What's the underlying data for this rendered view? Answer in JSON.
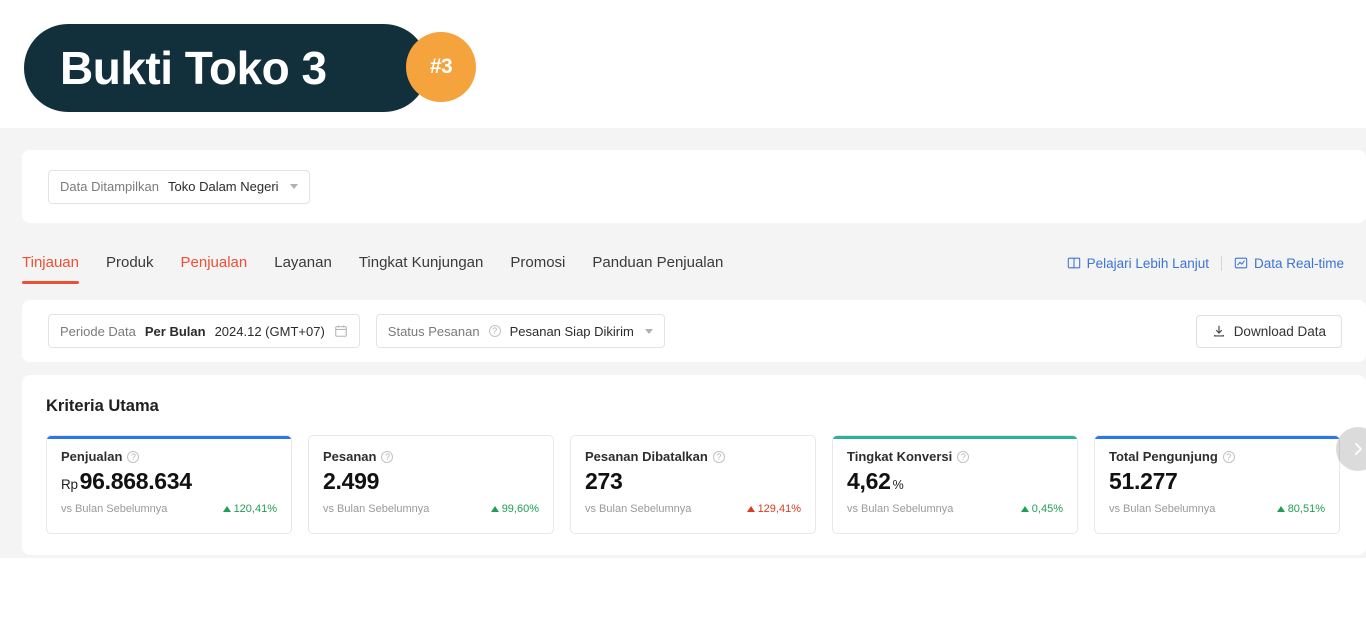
{
  "banner": {
    "title": "Bukti Toko 3",
    "badge": "#3",
    "bg_color": "#12303c",
    "badge_color": "#f5a33c"
  },
  "theme": {
    "accent_red": "#ee5033",
    "link_blue": "#3b74d6",
    "card_blue": "#2878e8",
    "card_green": "#2bb0a0",
    "up_green": "#1f9f55",
    "down_red": "#dd3a20"
  },
  "data_scope": {
    "label": "Data Ditampilkan",
    "value": "Toko Dalam Negeri",
    "chevron_icon": "chevron-down-icon"
  },
  "nav": {
    "tabs": [
      {
        "label": "Tinjauan",
        "state": "active"
      },
      {
        "label": "Produk",
        "state": "normal"
      },
      {
        "label": "Penjualan",
        "state": "highlight"
      },
      {
        "label": "Layanan",
        "state": "normal"
      },
      {
        "label": "Tingkat Kunjungan",
        "state": "normal"
      },
      {
        "label": "Promosi",
        "state": "normal"
      },
      {
        "label": "Panduan Penjualan",
        "state": "normal"
      }
    ],
    "links": [
      {
        "label": "Pelajari Lebih Lanjut",
        "icon": "book-icon"
      },
      {
        "label": "Data Real-time",
        "icon": "chart-icon"
      }
    ]
  },
  "filters": {
    "period": {
      "label": "Periode Data",
      "granularity": "Per Bulan",
      "value": "2024.12 (GMT+07)",
      "icon": "calendar-icon"
    },
    "order_status": {
      "label": "Status Pesanan",
      "help_icon": "question-icon",
      "value": "Pesanan Siap Dikirim",
      "chevron_icon": "chevron-down-icon"
    },
    "download": {
      "label": "Download Data",
      "icon": "download-icon"
    }
  },
  "metrics_section": {
    "title": "Kriteria Utama",
    "comparison_label": "vs Bulan Sebelumnya",
    "next_icon": "chevron-right-icon",
    "cards": [
      {
        "title": "Penjualan",
        "help_icon": "question-icon",
        "unit_prefix": "Rp",
        "value": "96.868.634",
        "unit_suffix": "",
        "compare_label": "vs Bulan Sebelumnya",
        "delta": "120,41%",
        "delta_direction": "up",
        "accent": "blue"
      },
      {
        "title": "Pesanan",
        "help_icon": "question-icon",
        "unit_prefix": "",
        "value": "2.499",
        "unit_suffix": "",
        "compare_label": "vs Bulan Sebelumnya",
        "delta": "99,60%",
        "delta_direction": "up",
        "accent": "none"
      },
      {
        "title": "Pesanan Dibatalkan",
        "help_icon": "question-icon",
        "unit_prefix": "",
        "value": "273",
        "unit_suffix": "",
        "compare_label": "vs Bulan Sebelumnya",
        "delta": "129,41%",
        "delta_direction": "down",
        "accent": "none"
      },
      {
        "title": "Tingkat Konversi",
        "help_icon": "question-icon",
        "unit_prefix": "",
        "value": "4,62",
        "unit_suffix": "%",
        "compare_label": "vs Bulan Sebelumnya",
        "delta": "0,45%",
        "delta_direction": "up",
        "accent": "green"
      },
      {
        "title": "Total Pengunjung",
        "help_icon": "question-icon",
        "unit_prefix": "",
        "value": "51.277",
        "unit_suffix": "",
        "compare_label": "vs Bulan Sebelumnya",
        "delta": "80,51%",
        "delta_direction": "up",
        "accent": "blue"
      }
    ]
  }
}
